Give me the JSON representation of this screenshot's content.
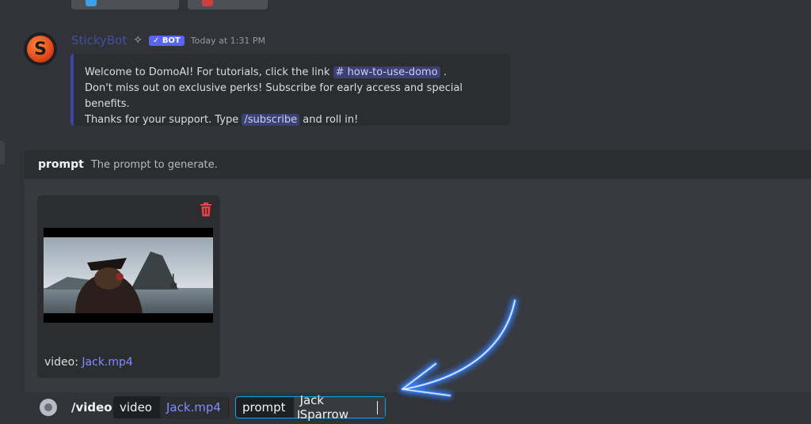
{
  "message": {
    "author": "StickyBot",
    "bot_badge": "BOT",
    "timestamp": "Today at 1:31 PM",
    "avatar_letter": "S",
    "embed": {
      "line1_pre": "Welcome to DomoAI! For tutorials, click the link",
      "channel_mention": "# how-to-use-domo",
      "line1_post": ".",
      "line2": "Don't miss out on exclusive perks! Subscribe for early access and special benefits.",
      "line3_pre": "Thanks for your support. Type",
      "command_mention": "/subscribe",
      "line3_post": "and roll in!"
    }
  },
  "prompt_hint": {
    "name": "prompt",
    "description": "The prompt to generate."
  },
  "attachment": {
    "label_prefix": "video:",
    "filename": "Jack.mp4"
  },
  "command": {
    "name": "/video",
    "options": [
      {
        "name": "video",
        "value": "Jack.mp4"
      },
      {
        "name": "prompt",
        "value": "Jack Sparrow"
      }
    ]
  },
  "colors": {
    "accent": "#5865f2",
    "link": "#7f8cff",
    "danger": "#f23f43",
    "neon": "#3b82ff"
  },
  "icons": {
    "delete": "trash-icon",
    "sparkle": "sparkle-icon",
    "verified": "checkmark-icon"
  }
}
